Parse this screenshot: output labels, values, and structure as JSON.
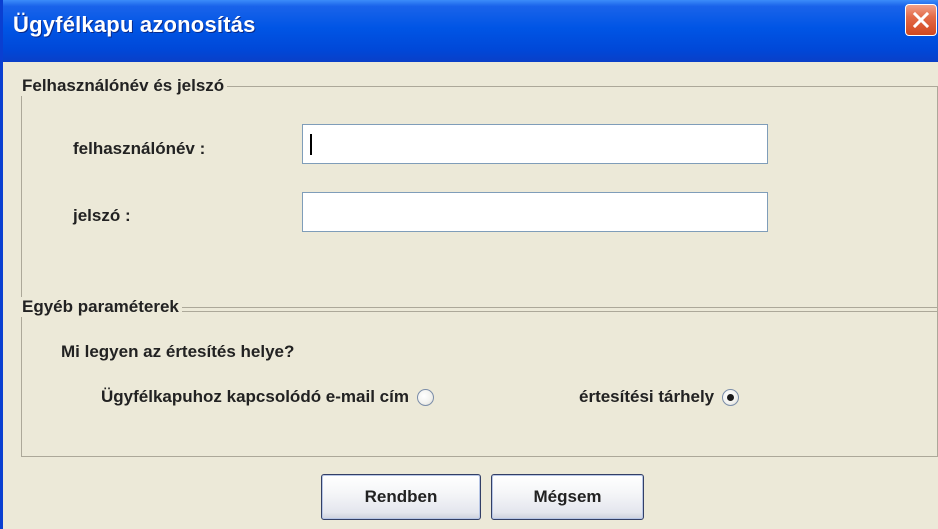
{
  "window": {
    "title": "Ügyfélkapu azonosítás",
    "close_icon": "close-icon",
    "title_color": "#0055e5",
    "close_color": "#e36b48"
  },
  "login_group": {
    "legend": "Felhasználónév és jelszó",
    "username_label": "felhasználónév :",
    "username_value": "",
    "password_label": "jelszó :",
    "password_value": ""
  },
  "other_group": {
    "legend": "Egyéb paraméterek",
    "question": "Mi legyen az értesítés helye?",
    "options": [
      {
        "label": "Ügyfélkapuhoz kapcsolódó e-mail cím",
        "selected": false
      },
      {
        "label": "értesítési tárhely",
        "selected": true
      }
    ]
  },
  "buttons": {
    "ok_label": "Rendben",
    "cancel_label": "Mégsem"
  }
}
